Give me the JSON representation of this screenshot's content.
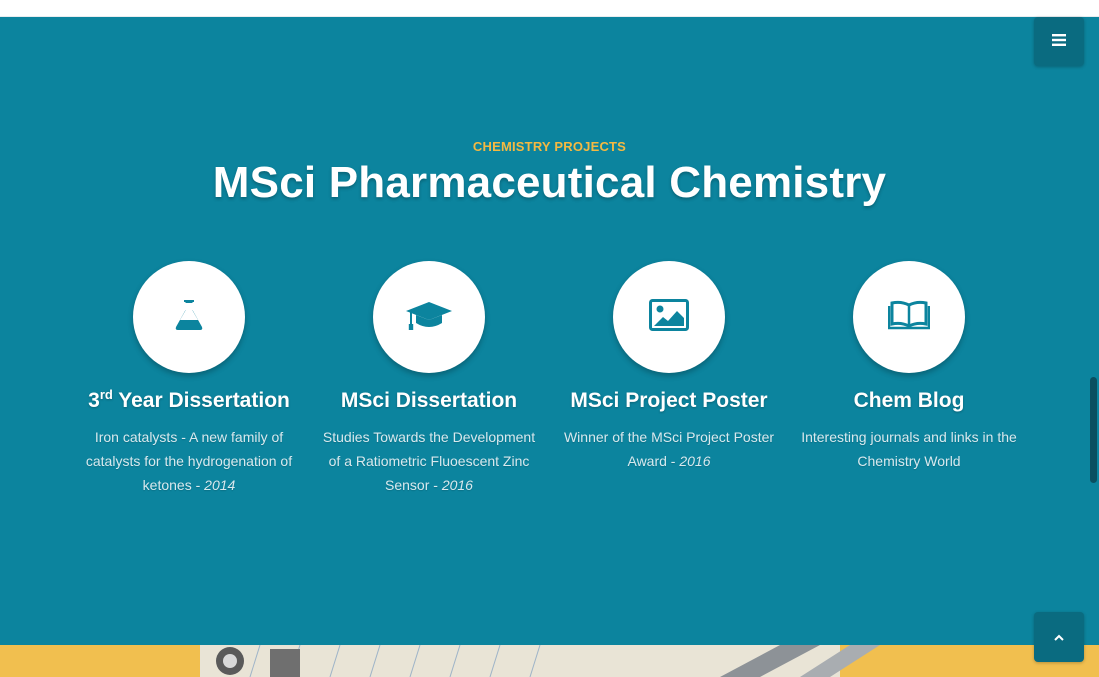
{
  "section": {
    "kicker": "CHEMISTRY PROJECTS",
    "title": "MSci Pharmaceutical Chemistry"
  },
  "items": [
    {
      "icon": "flask-icon",
      "title_main": "3",
      "title_sup": "rd",
      "title_rest": " Year Dissertation",
      "desc": "Iron catalysts - A new family of catalysts for the hydrogenation of ketones - ",
      "year": "2014"
    },
    {
      "icon": "graduation-cap-icon",
      "title": "MSci Dissertation",
      "desc": "Studies Towards the Development of a Ratiometric Fluoescent Zinc Sensor - ",
      "year": "2016"
    },
    {
      "icon": "image-icon",
      "title": "MSci Project Poster",
      "desc": "Winner of the MSci Project Poster Award - ",
      "year": "2016"
    },
    {
      "icon": "book-icon",
      "title": "Chem Blog",
      "desc": "Interesting journals and links in the Chemistry World"
    }
  ],
  "colors": {
    "section_bg": "#0c849e",
    "accent": "#f4b942",
    "icon": "#0c849e"
  }
}
